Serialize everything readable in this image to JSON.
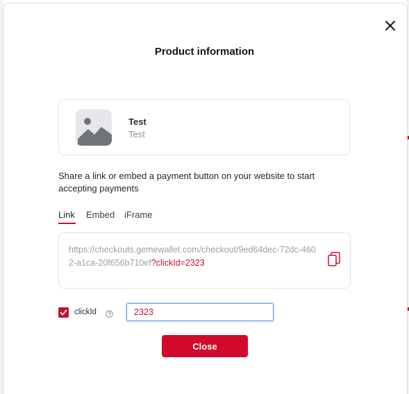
{
  "modal": {
    "title": "Product information",
    "close_icon": "close-icon"
  },
  "product": {
    "name": "Test",
    "description": "Test",
    "image_icon": "image-placeholder-icon"
  },
  "share_text": "Share a link or embed a payment button on your website to start accepting payments",
  "tabs": [
    {
      "label": "Link",
      "active": true
    },
    {
      "label": "Embed",
      "active": false
    },
    {
      "label": "iFrame",
      "active": false
    }
  ],
  "link": {
    "base_url": "https://checkouts.gemewallet.com/checkout/9ed64dec-72dc-4602-a1ca-20f656b710ef",
    "param": "?clickId=2323",
    "copy_icon": "copy-icon"
  },
  "click_id": {
    "checked": true,
    "label": "clickId",
    "help_icon": "help-circle-icon",
    "value": "2323"
  },
  "actions": {
    "close_label": "Close"
  },
  "colors": {
    "accent": "#c8102e",
    "focus": "#5c8ef2",
    "border": "#e1e3e6"
  }
}
